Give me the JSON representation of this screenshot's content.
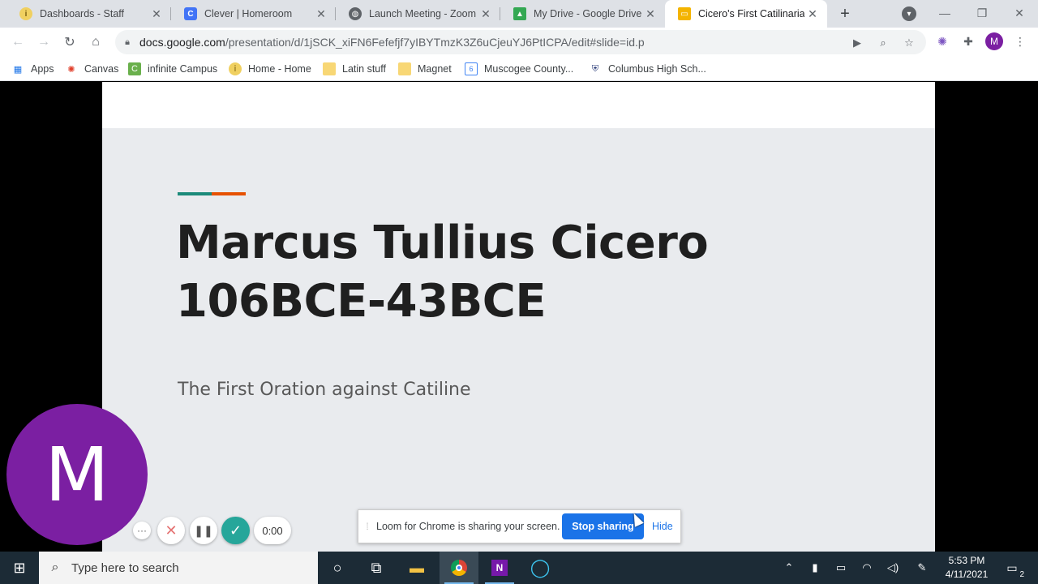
{
  "browser": {
    "tabs": [
      {
        "title": "Dashboards - Staff",
        "favicon": "infinite-campus-icon",
        "color": "#f0d060",
        "glyph": "i"
      },
      {
        "title": "Clever | Homeroom",
        "favicon": "clever-icon",
        "color": "#4274f6",
        "glyph": "C"
      },
      {
        "title": "Launch Meeting - Zoom",
        "favicon": "globe-icon",
        "color": "#5f6368",
        "glyph": "◍"
      },
      {
        "title": "My Drive - Google Drive",
        "favicon": "google-drive-icon",
        "color": "#34a853",
        "glyph": "▲"
      },
      {
        "title": "Cicero's First Catilinarian",
        "favicon": "google-slides-icon",
        "color": "#f4b400",
        "glyph": "▭",
        "active": true
      }
    ],
    "close_glyph": "✕",
    "new_tab_glyph": "+",
    "address": {
      "host": "docs.google.com",
      "path": "/presentation/d/1jSCK_xiFN6Fefefjf7yIBYTmzK3Z6uCjeuYJ6PtICPA/edit#slide=id.p"
    },
    "profile_initial": "M",
    "bookmarks": [
      {
        "label": "Apps",
        "icon": "apps-grid-icon"
      },
      {
        "label": "Canvas",
        "icon": "canvas-icon"
      },
      {
        "label": "infinite Campus",
        "icon": "campus-icon"
      },
      {
        "label": "Home - Home",
        "icon": "home-bookmark-icon"
      },
      {
        "label": "Latin stuff",
        "icon": "folder-icon"
      },
      {
        "label": "Magnet",
        "icon": "folder-icon"
      },
      {
        "label": "Muscogee County...",
        "icon": "calendar-icon"
      },
      {
        "label": "Columbus High Sch...",
        "icon": "school-shield-icon"
      }
    ]
  },
  "slide": {
    "title_line1": "Marcus Tullius Cicero",
    "title_line2": "106BCE-43BCE",
    "subtitle": "The First Oration against Catiline",
    "accent_colors": [
      "#1b8a7a",
      "#e65100"
    ]
  },
  "loom": {
    "avatar_initial": "M",
    "timer": "0:00",
    "share_message": "Loom for Chrome is sharing your screen.",
    "stop_label": "Stop sharing",
    "hide_label": "Hide"
  },
  "taskbar": {
    "search_placeholder": "Type here to search",
    "time": "5:53 PM",
    "date": "4/11/2021",
    "notification_count": "2"
  }
}
